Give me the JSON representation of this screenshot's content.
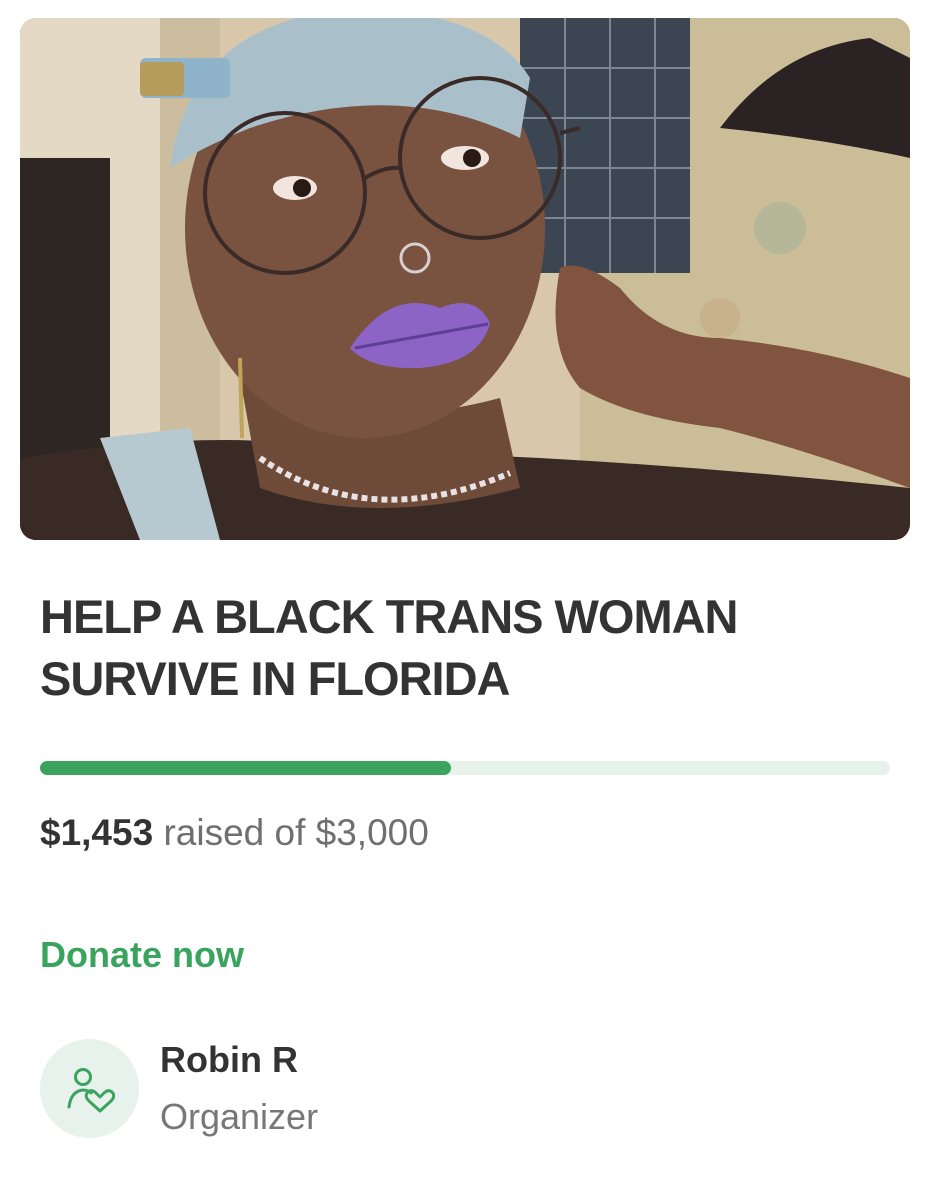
{
  "campaign": {
    "title_line1": "HELP A BLACK TRANS WOMAN",
    "title_line2": "SURVIVE IN FLORIDA",
    "raised": "$1,453",
    "raised_suffix": "raised of $3,000",
    "progress_fraction": 0.484,
    "donate_label": "Donate now"
  },
  "organizer": {
    "name": "Robin R",
    "role": "Organizer",
    "icon": "user-heart-icon"
  },
  "colors": {
    "accent": "#3aa45e",
    "progress_track": "#e7f2ec",
    "avatar_bg": "#e7f2ec",
    "text": "#333333",
    "muted_text": "#6f6f6f"
  }
}
